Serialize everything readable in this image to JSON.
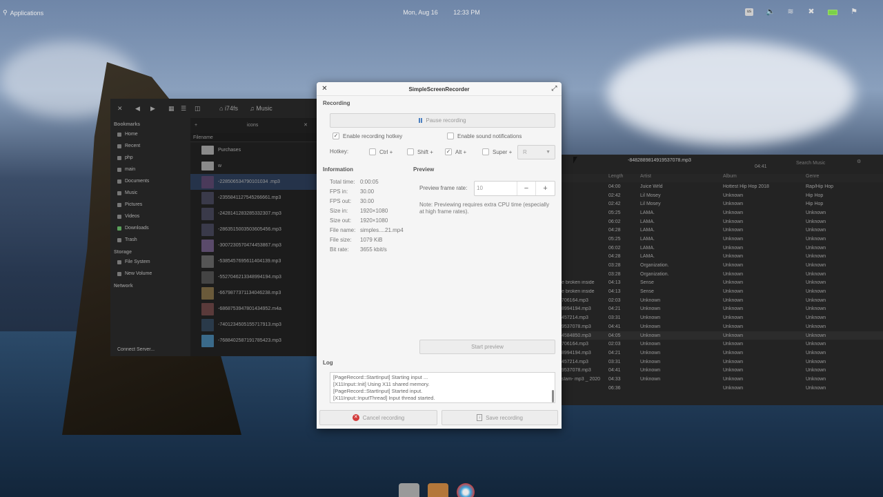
{
  "panel": {
    "applications": "Applications",
    "date": "Mon, Aug 16",
    "time": "12:33 PM",
    "keyboard_layout": "us",
    "tray_icons": [
      "keyboard-layout-icon",
      "volume-icon",
      "wifi-icon",
      "bluetooth-icon",
      "battery-icon",
      "notifications-icon"
    ]
  },
  "file_manager": {
    "breadcrumb": [
      "i74fs",
      "Music"
    ],
    "tab_label": "icons",
    "sidebar": {
      "bookmarks_header": "Bookmarks",
      "bookmarks": [
        "Home",
        "Recent",
        "php",
        "main",
        "Documents",
        "Music",
        "Pictures",
        "Videos",
        "Downloads",
        "Trash"
      ],
      "storage_header": "Storage",
      "storage": [
        "File System",
        "New Volume"
      ],
      "network_header": "Network",
      "connect_server": "Connect Server..."
    },
    "column_filename": "Filename",
    "files": [
      "Purchases",
      "w",
      "-228506534790101034  .mp3",
      "-2355841127545266661.mp3",
      "-2428141283285332307.mp3",
      "-2863515003503605456.mp3",
      "-3007230570474453867.mp3",
      "-5385457695611404139.mp3",
      "-5527046213348994194.mp3",
      "-6679877371134046238.mp3",
      "-6868753947801434952.m4a",
      "-7401234505155717913.mp3",
      "-7688402587191785423.mp3"
    ]
  },
  "music_player": {
    "now_playing": "-8482889814919537078.mp3",
    "time_left": "04:41",
    "search_placeholder": "Search Music",
    "columns": [
      "Length",
      "Artist",
      "Album",
      "Genre"
    ],
    "rows": [
      {
        "name": "",
        "length": "04:00",
        "artist": "Juice Wrld",
        "album": "Hottest Hip Hop 2018",
        "genre": "Rap/Hip Hop"
      },
      {
        "name": "",
        "length": "02:42",
        "artist": "Lil Mosey",
        "album": "Unknown",
        "genre": "Hip Hop"
      },
      {
        "name": "",
        "length": "02:42",
        "artist": "Lil Mosey",
        "album": "Unknown",
        "genre": "Hip Hop"
      },
      {
        "name": "",
        "length": "05:25",
        "artist": "LAMA.",
        "album": "Unknown",
        "genre": "Unknown"
      },
      {
        "name": "",
        "length": "06:02",
        "artist": "LAMA.",
        "album": "Unknown",
        "genre": "Unknown"
      },
      {
        "name": "",
        "length": "04:28",
        "artist": "LAMA.",
        "album": "Unknown",
        "genre": "Unknown"
      },
      {
        "name": "",
        "length": "05:25",
        "artist": "LAMA.",
        "album": "Unknown",
        "genre": "Unknown"
      },
      {
        "name": "",
        "length": "06:02",
        "artist": "LAMA.",
        "album": "Unknown",
        "genre": "Unknown"
      },
      {
        "name": "",
        "length": "04:28",
        "artist": "LAMA.",
        "album": "Unknown",
        "genre": "Unknown"
      },
      {
        "name": "",
        "length": "03:28",
        "artist": "Organization.",
        "album": "Unknown",
        "genre": "Unknown"
      },
      {
        "name": "",
        "length": "03:28",
        "artist": "Organization.",
        "album": "Unknown",
        "genre": "Unknown"
      },
      {
        "name": "e broken inside",
        "length": "04:13",
        "artist": "Sense",
        "album": "Unknown",
        "genre": "Unknown"
      },
      {
        "name": "e broken inside",
        "length": "04:13",
        "artist": "Sense",
        "album": "Unknown",
        "genre": "Unknown"
      },
      {
        "name": "706164.mp3",
        "length": "02:03",
        "artist": "Unknown",
        "album": "Unknown",
        "genre": "Unknown"
      },
      {
        "name": "8994194.mp3",
        "length": "04:21",
        "artist": "Unknown",
        "album": "Unknown",
        "genre": "Unknown"
      },
      {
        "name": "457214.mp3",
        "length": "03:31",
        "artist": "Unknown",
        "album": "Unknown",
        "genre": "Unknown"
      },
      {
        "name": "9537078.mp3",
        "length": "04:41",
        "artist": "Unknown",
        "album": "Unknown",
        "genre": "Unknown"
      },
      {
        "name": "4584850.mp3",
        "length": "04:05",
        "artist": "Unknown",
        "album": "Unknown",
        "genre": "Unknown"
      },
      {
        "name": "706164.mp3",
        "length": "02:03",
        "artist": "Unknown",
        "album": "Unknown",
        "genre": "Unknown"
      },
      {
        "name": "8994194.mp3",
        "length": "04:21",
        "artist": "Unknown",
        "album": "Unknown",
        "genre": "Unknown"
      },
      {
        "name": "457214.mp3",
        "length": "03:31",
        "artist": "Unknown",
        "album": "Unknown",
        "genre": "Unknown"
      },
      {
        "name": "9537078.mp3",
        "length": "04:41",
        "artist": "Unknown",
        "album": "Unknown",
        "genre": "Unknown"
      },
      {
        "name": "slam- mp3 _ 2020",
        "length": "04:33",
        "artist": "Unknown",
        "album": "Unknown",
        "genre": "Unknown"
      },
      {
        "name": "",
        "length": "06:36",
        "artist": "",
        "album": "Unknown",
        "genre": "Unknown"
      }
    ]
  },
  "dialog": {
    "title": "SimpleScreenRecorder",
    "recording_section": "Recording",
    "pause_button": "Pause recording",
    "enable_hotkey": "Enable recording hotkey",
    "enable_sound": "Enable sound notifications",
    "hotkey_label": "Hotkey:",
    "modifiers": [
      {
        "label": "Ctrl +",
        "checked": false
      },
      {
        "label": "Shift +",
        "checked": false
      },
      {
        "label": "Alt +",
        "checked": true
      },
      {
        "label": "Super +",
        "checked": false
      }
    ],
    "hotkey_key": "R",
    "information_section": "Information",
    "info": [
      {
        "key": "Total time:",
        "value": "0:00:05"
      },
      {
        "key": "FPS in:",
        "value": "30.00"
      },
      {
        "key": "FPS out:",
        "value": "30.00"
      },
      {
        "key": "Size in:",
        "value": "1920×1080"
      },
      {
        "key": "Size out:",
        "value": "1920×1080"
      },
      {
        "key": "File name:",
        "value": "simples....21.mp4"
      },
      {
        "key": "File size:",
        "value": "1079 KiB"
      },
      {
        "key": "Bit rate:",
        "value": "3655 kbit/s"
      }
    ],
    "preview_section": "Preview",
    "preview_rate_label": "Preview frame rate:",
    "preview_rate_value": "10",
    "preview_note": "Note: Previewing requires extra CPU time (especially at high frame rates).",
    "start_preview": "Start preview",
    "log_section": "Log",
    "log_lines": [
      "[PageRecord::StartInput] Starting input ...",
      "[X11Input::Init] Using X11 shared memory.",
      "[PageRecord::StartInput] Started input.",
      "[X11Input::InputThread] Input thread started."
    ],
    "cancel_button": "Cancel recording",
    "save_button": "Save recording"
  }
}
